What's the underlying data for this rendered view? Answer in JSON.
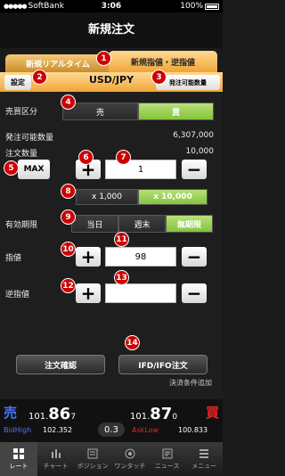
{
  "status": {
    "carrier": "SoftBank",
    "time": "3:06",
    "battery": "100%"
  },
  "header": {
    "title": "新規注文"
  },
  "tabs": {
    "left": "新規リアルタイム",
    "right": "新規指値・逆指値"
  },
  "pairbar": {
    "settings": "設定",
    "pair": "USD/JPY",
    "orderable": "発注可能数量"
  },
  "form": {
    "side_label": "売買区分",
    "sell": "売",
    "buy": "買",
    "orderable_label": "発注可能数量",
    "orderable_value": "6,307,000",
    "qty_label": "注文数量",
    "qty_unit": "10,000",
    "max": "MAX",
    "qty_value": "1",
    "x1000": "x 1,000",
    "x10000": "x 10,000",
    "expiry_label": "有効期限",
    "today": "当日",
    "weekend": "週末",
    "indefinite": "無期限",
    "limit_label": "指値",
    "limit_value": "98",
    "stop_label": "逆指値",
    "stop_value": "",
    "confirm": "注文確認",
    "ifd": "IFD/IFO注文",
    "add_settle": "決済条件追加"
  },
  "badges": [
    "1",
    "2",
    "3",
    "4",
    "5",
    "6",
    "7",
    "8",
    "9",
    "10",
    "11",
    "12",
    "13",
    "14"
  ],
  "rates": {
    "sell": "売",
    "buy": "買",
    "bid_main": "101.",
    "bid_big": "86",
    "bid_small": "7",
    "ask_main": "101.",
    "ask_big": "87",
    "ask_small": "0",
    "bidhigh_label": "BidHigh",
    "bidhigh_value": "102.352",
    "spread": "0.3",
    "asklow_label": "AskLow",
    "asklow_value": "100.833"
  },
  "nav": [
    {
      "label": "レート",
      "icon": "grid-icon"
    },
    {
      "label": "チャート",
      "icon": "chart-icon"
    },
    {
      "label": "ポジション",
      "icon": "position-icon"
    },
    {
      "label": "ワンタッチ",
      "icon": "onetouch-icon"
    },
    {
      "label": "ニュース",
      "icon": "news-icon"
    },
    {
      "label": "メニュー",
      "icon": "menu-icon"
    }
  ]
}
